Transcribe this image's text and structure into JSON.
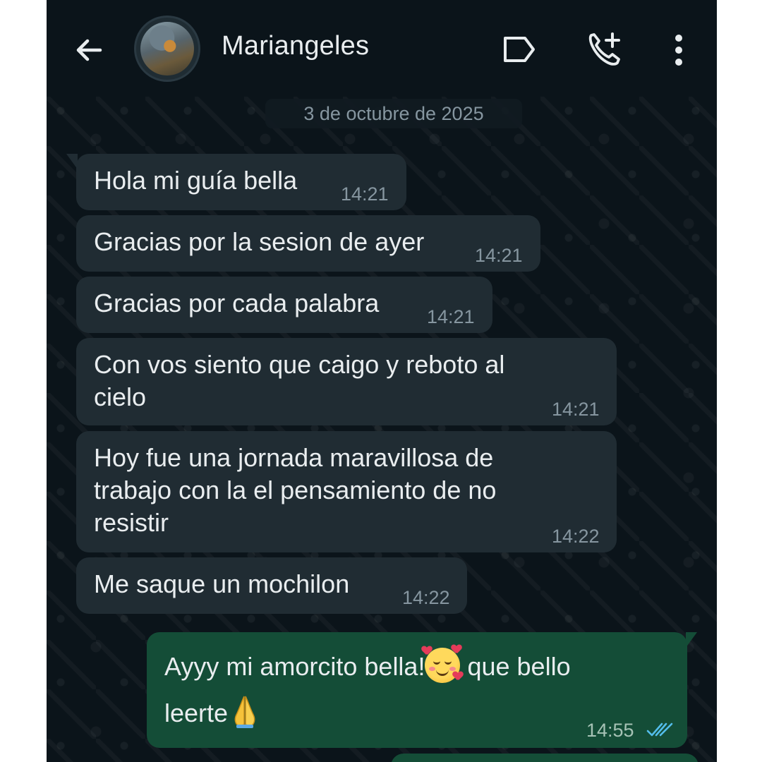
{
  "header": {
    "contact_name": "Mariangeles",
    "icons": [
      "back-arrow-icon",
      "contact-avatar",
      "label-icon",
      "add-call-icon",
      "more-vert-icon"
    ]
  },
  "date_divider": "3 de octubre de 2025",
  "messages": [
    {
      "direction": "incoming",
      "lines": [
        "Hola mi guía bella"
      ],
      "time": "14:21"
    },
    {
      "direction": "incoming",
      "lines": [
        "Gracias por la sesion de ayer"
      ],
      "time": "14:21"
    },
    {
      "direction": "incoming",
      "lines": [
        "Gracias por cada palabra"
      ],
      "time": "14:21"
    },
    {
      "direction": "incoming",
      "lines": [
        "Con vos siento que caigo y reboto al",
        "cielo"
      ],
      "time": "14:21"
    },
    {
      "direction": "incoming",
      "lines": [
        "Hoy fue una jornada maravillosa de",
        "trabajo con la el pensamiento de no",
        "resistir"
      ],
      "time": "14:22"
    },
    {
      "direction": "incoming",
      "lines": [
        "Me saque un mochilon"
      ],
      "time": "14:22"
    },
    {
      "direction": "outgoing",
      "line1_a": "Ayyy mi amorcito bella!",
      "line1_b": " que bello",
      "line2": "leerte",
      "emojis": [
        "smiling-face-with-hearts",
        "folded-hands"
      ],
      "time": "14:55",
      "status": "read"
    }
  ],
  "colors": {
    "background": "#0b141a",
    "incoming_bubble": "#202c33",
    "outgoing_bubble": "#144d37",
    "timestamp": "#8696a0",
    "read_ticks": "#53bdeb"
  }
}
